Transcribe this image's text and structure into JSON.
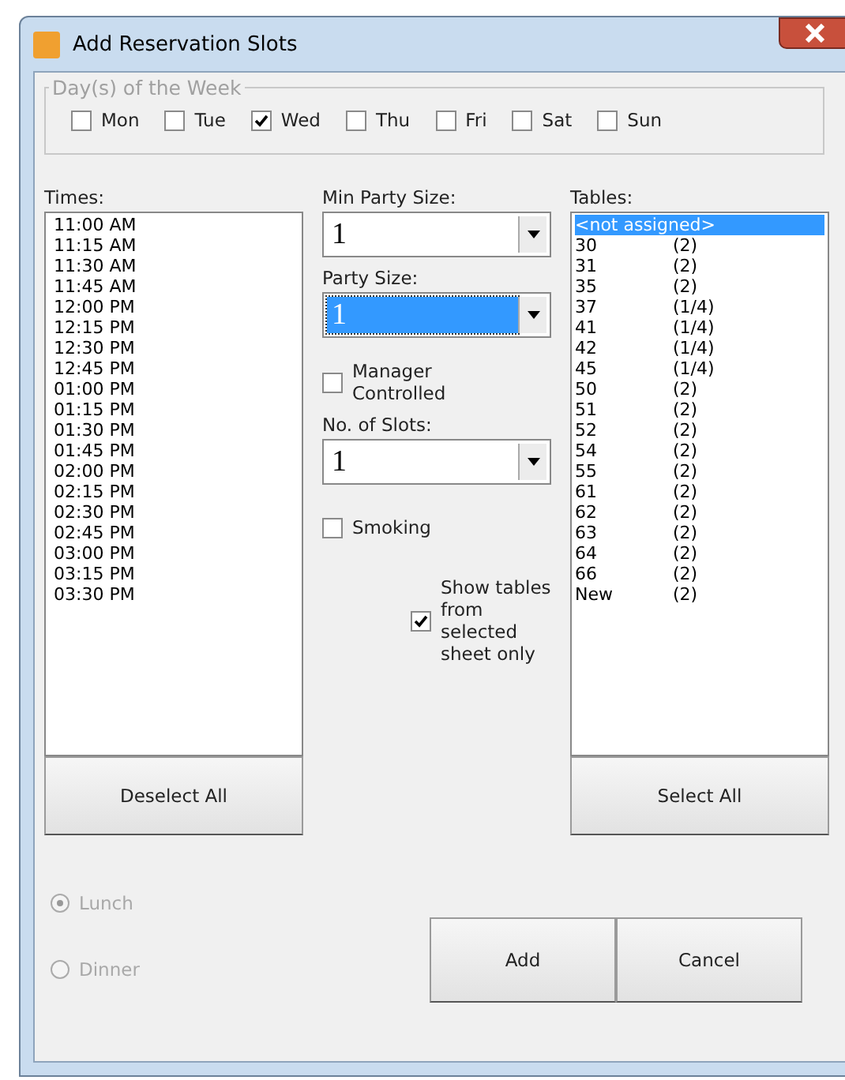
{
  "window": {
    "title": "Add Reservation Slots"
  },
  "days_group": {
    "title": "Day(s) of the Week",
    "days": [
      {
        "label": "Mon",
        "checked": false
      },
      {
        "label": "Tue",
        "checked": false
      },
      {
        "label": "Wed",
        "checked": true
      },
      {
        "label": "Thu",
        "checked": false
      },
      {
        "label": "Fri",
        "checked": false
      },
      {
        "label": "Sat",
        "checked": false
      },
      {
        "label": "Sun",
        "checked": false
      }
    ]
  },
  "times": {
    "label": "Times:",
    "items": [
      "11:00 AM",
      "11:15 AM",
      "11:30 AM",
      "11:45 AM",
      "12:00 PM",
      "12:15 PM",
      "12:30 PM",
      "12:45 PM",
      "01:00 PM",
      "01:15 PM",
      "01:30 PM",
      "01:45 PM",
      "02:00 PM",
      "02:15 PM",
      "02:30 PM",
      "02:45 PM",
      "03:00 PM",
      "03:15 PM",
      "03:30 PM"
    ],
    "button": "Deselect All"
  },
  "min_party_size": {
    "label": "Min Party Size:",
    "value": "1",
    "focused": false
  },
  "party_size": {
    "label": "Party Size:",
    "value": "1",
    "focused": true
  },
  "manager_controlled": {
    "label": "Manager Controlled",
    "checked": false
  },
  "no_of_slots": {
    "label": "No. of Slots:",
    "value": "1",
    "focused": false
  },
  "smoking": {
    "label": "Smoking",
    "checked": false
  },
  "show_tables": {
    "label": "Show tables from selected sheet only",
    "checked": true
  },
  "tables": {
    "label": "Tables:",
    "items": [
      {
        "name": "<not assigned>",
        "selected": true
      },
      {
        "name": "30",
        "seats": "(2)",
        "selected": false
      },
      {
        "name": "31",
        "seats": "(2)",
        "selected": false
      },
      {
        "name": "35",
        "seats": "(2)",
        "selected": false
      },
      {
        "name": "37",
        "seats": "(1/4)",
        "selected": false
      },
      {
        "name": "41",
        "seats": "(1/4)",
        "selected": false
      },
      {
        "name": "42",
        "seats": "(1/4)",
        "selected": false
      },
      {
        "name": "45",
        "seats": "(1/4)",
        "selected": false
      },
      {
        "name": "50",
        "seats": "(2)",
        "selected": false
      },
      {
        "name": "51",
        "seats": "(2)",
        "selected": false
      },
      {
        "name": "52",
        "seats": "(2)",
        "selected": false
      },
      {
        "name": "54",
        "seats": "(2)",
        "selected": false
      },
      {
        "name": "55",
        "seats": "(2)",
        "selected": false
      },
      {
        "name": "61",
        "seats": "(2)",
        "selected": false
      },
      {
        "name": "62",
        "seats": "(2)",
        "selected": false
      },
      {
        "name": "63",
        "seats": "(2)",
        "selected": false
      },
      {
        "name": "64",
        "seats": "(2)",
        "selected": false
      },
      {
        "name": "66",
        "seats": "(2)",
        "selected": false
      },
      {
        "name": "New",
        "seats": "(2)",
        "selected": false
      }
    ],
    "button": "Select All"
  },
  "meal": [
    {
      "label": "Lunch",
      "selected": true,
      "disabled": true
    },
    {
      "label": "Dinner",
      "selected": false,
      "disabled": true
    }
  ],
  "buttons": [
    "Add",
    "Cancel"
  ]
}
